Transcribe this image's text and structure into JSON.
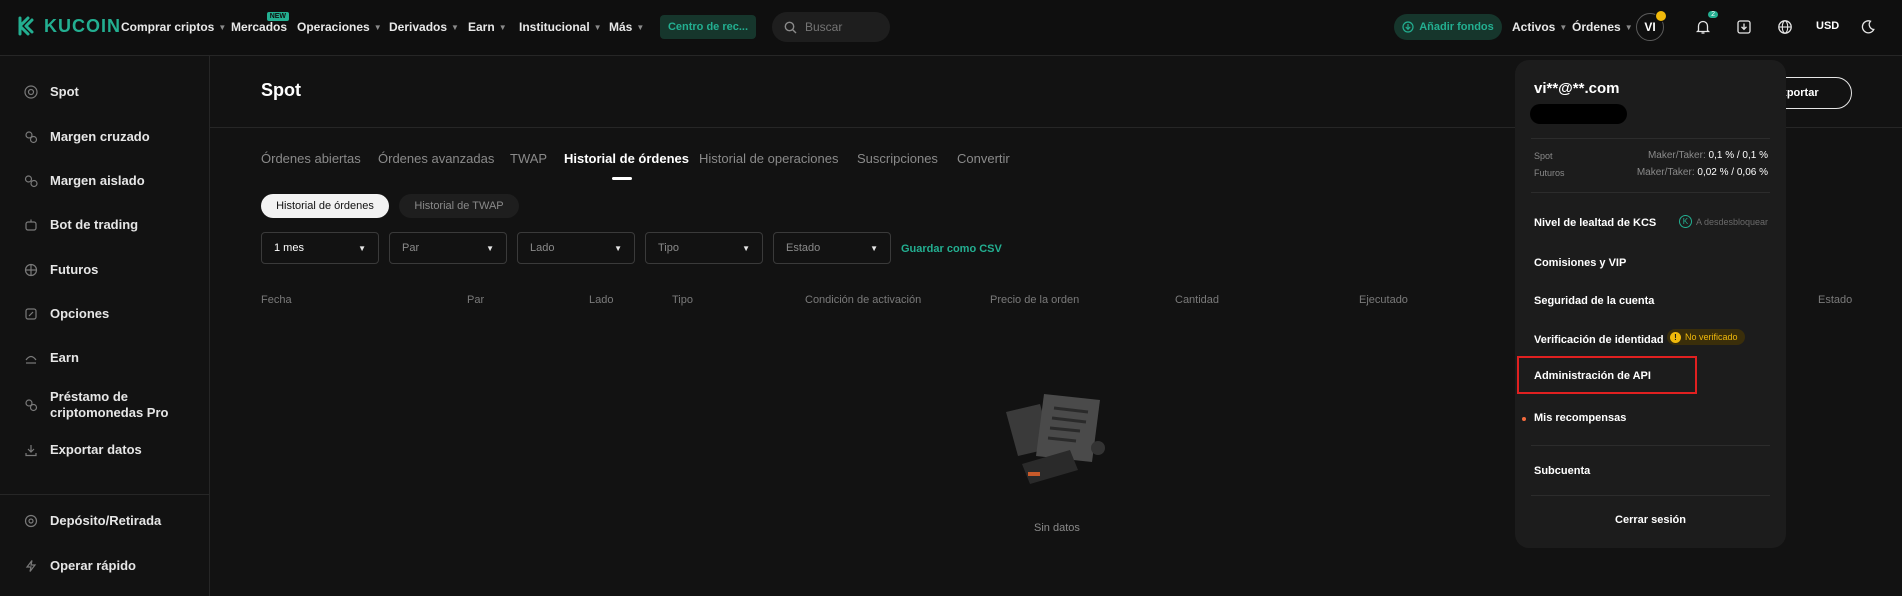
{
  "brand": {
    "name": "KUCOIN",
    "accent": "#23af91"
  },
  "nav": {
    "items": [
      {
        "label": "Comprar criptos",
        "caret": true
      },
      {
        "label": "Mercados",
        "caret": false,
        "badge": "NEW"
      },
      {
        "label": "Operaciones",
        "caret": true
      },
      {
        "label": "Derivados",
        "caret": true
      },
      {
        "label": "Earn",
        "caret": true
      },
      {
        "label": "Institucional",
        "caret": true
      },
      {
        "label": "Más",
        "caret": true
      }
    ],
    "center_label": "Centro de rec...",
    "search_placeholder": "Buscar",
    "add_funds": "Añadir fondos",
    "assets": "Activos",
    "orders": "Órdenes",
    "avatar": "VI",
    "notifications": "2",
    "currency": "USD"
  },
  "sidebar": {
    "items": [
      {
        "label": "Spot",
        "icon": "spot-icon"
      },
      {
        "label": "Margen cruzado",
        "icon": "cross-margin-icon"
      },
      {
        "label": "Margen aislado",
        "icon": "isolated-margin-icon"
      },
      {
        "label": "Bot de trading",
        "icon": "bot-icon"
      },
      {
        "label": "Futuros",
        "icon": "futures-icon"
      },
      {
        "label": "Opciones",
        "icon": "options-icon"
      },
      {
        "label": "Earn",
        "icon": "earn-icon"
      },
      {
        "label": "Préstamo de\ncriptomonedas Pro",
        "icon": "loan-icon"
      },
      {
        "label": "Exportar datos",
        "icon": "export-icon"
      },
      {
        "label": "Depósito/Retirada",
        "icon": "deposit-icon"
      },
      {
        "label": "Operar rápido",
        "icon": "quick-trade-icon"
      }
    ]
  },
  "main": {
    "title": "Spot",
    "export_label": "Exportar",
    "tabs": [
      {
        "label": "Órdenes abiertas",
        "active": false
      },
      {
        "label": "Órdenes avanzadas",
        "active": false
      },
      {
        "label": "TWAP",
        "active": false
      },
      {
        "label": "Historial de órdenes",
        "active": true
      },
      {
        "label": "Historial de operaciones",
        "active": false
      },
      {
        "label": "Suscripciones",
        "active": false
      },
      {
        "label": "Convertir",
        "active": false
      }
    ],
    "subtabs": [
      {
        "label": "Historial de órdenes",
        "active": true
      },
      {
        "label": "Historial de TWAP",
        "active": false
      }
    ],
    "filters": [
      {
        "value": "1 mes",
        "filled": true
      },
      {
        "value": "Par",
        "filled": false
      },
      {
        "value": "Lado",
        "filled": false
      },
      {
        "value": "Tipo",
        "filled": false
      },
      {
        "value": "Estado",
        "filled": false
      }
    ],
    "save_csv": "Guardar como CSV",
    "columns": [
      "Fecha",
      "Par",
      "Lado",
      "Tipo",
      "Condición de activación",
      "Precio de la orden",
      "Cantidad",
      "Ejecutado",
      "Estado"
    ],
    "empty_text": "Sin datos"
  },
  "account_menu": {
    "email": "vi**@**.com",
    "fees": [
      {
        "label": "Spot",
        "prefix": "Maker/Taker:",
        "value": "0,1 % / 0,1 %"
      },
      {
        "label": "Futuros",
        "prefix": "Maker/Taker:",
        "value": "0,02 % / 0,06 %"
      }
    ],
    "loyalty": "Nivel de lealtad de KCS",
    "loyalty_badge": "A desdesbloquear",
    "items": {
      "fees_vip": "Comisiones y VIP",
      "security": "Seguridad de la cuenta",
      "identity": "Verificación de identidad",
      "identity_status": "No verificado",
      "api": "Administración de API",
      "rewards": "Mis recompensas",
      "subaccount": "Subcuenta"
    },
    "logout": "Cerrar sesión"
  }
}
